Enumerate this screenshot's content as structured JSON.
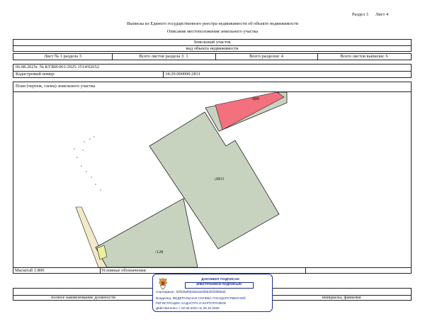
{
  "header": {
    "section": "Раздел 3",
    "sheet": "Лист 4",
    "title": "Выписка из Единого государственного реестра недвижимости об объекте недвижимости",
    "subtitle": "Описание местоположения земельного участка"
  },
  "object_box": {
    "object_name": "Земельный участок",
    "object_type_caption": "вид объекта недвижимости"
  },
  "sheet_row": {
    "sheet_of_section": "Лист № 1 раздела 3",
    "total_section_sheets": "Всего листов раздела 3: 1",
    "total_sections": "Всего разделов: 4",
    "total_extract_sheets": "Всего листов выписки: 6"
  },
  "info": {
    "date_number": "06.08.2025г. № КУВИ-001/2025-1514/02652",
    "cadastral_label": "Кадастровый номер:",
    "cadastral_number": "34:29:000000:2831"
  },
  "plan": {
    "caption": "План (чертеж, схема) земельного участка",
    "label_main": ":2831",
    "label_top": ":886",
    "label_bottom": ":128",
    "colors": {
      "main_fill": "#c8d3bf",
      "top_fill": "#f3707e",
      "bottom_fill": "#c8d3bf",
      "strip_fill": "#f2e9c8"
    }
  },
  "footer": {
    "scale": "Масштаб 1:800",
    "legend": "Условные обозначения:",
    "position_caption": "полное наименование должности",
    "name_caption": "инициалы, фамилия"
  },
  "stamp": {
    "title_1": "ДОКУМЕНТ ПОДПИСАН",
    "title_2": "ЭЛЕКТРОННОЙ ПОДПИСЬЮ",
    "line_1": "Сертификат: 00f1056bb3a6a3cbf5b3f4f2fd68a5",
    "line_2": "Владелец: ФЕДЕРАЛЬНАЯ СЛУЖБА ГОСУДАРСТВЕННОЙ",
    "line_3": "РЕГИСТРАЦИИ, КАДАСТРА И КАРТОГРАФИИ",
    "line_4": "Действителен: с 02.08.2024 по 26.10.2025",
    "emblem_icon": "coat-of-arms-icon"
  }
}
